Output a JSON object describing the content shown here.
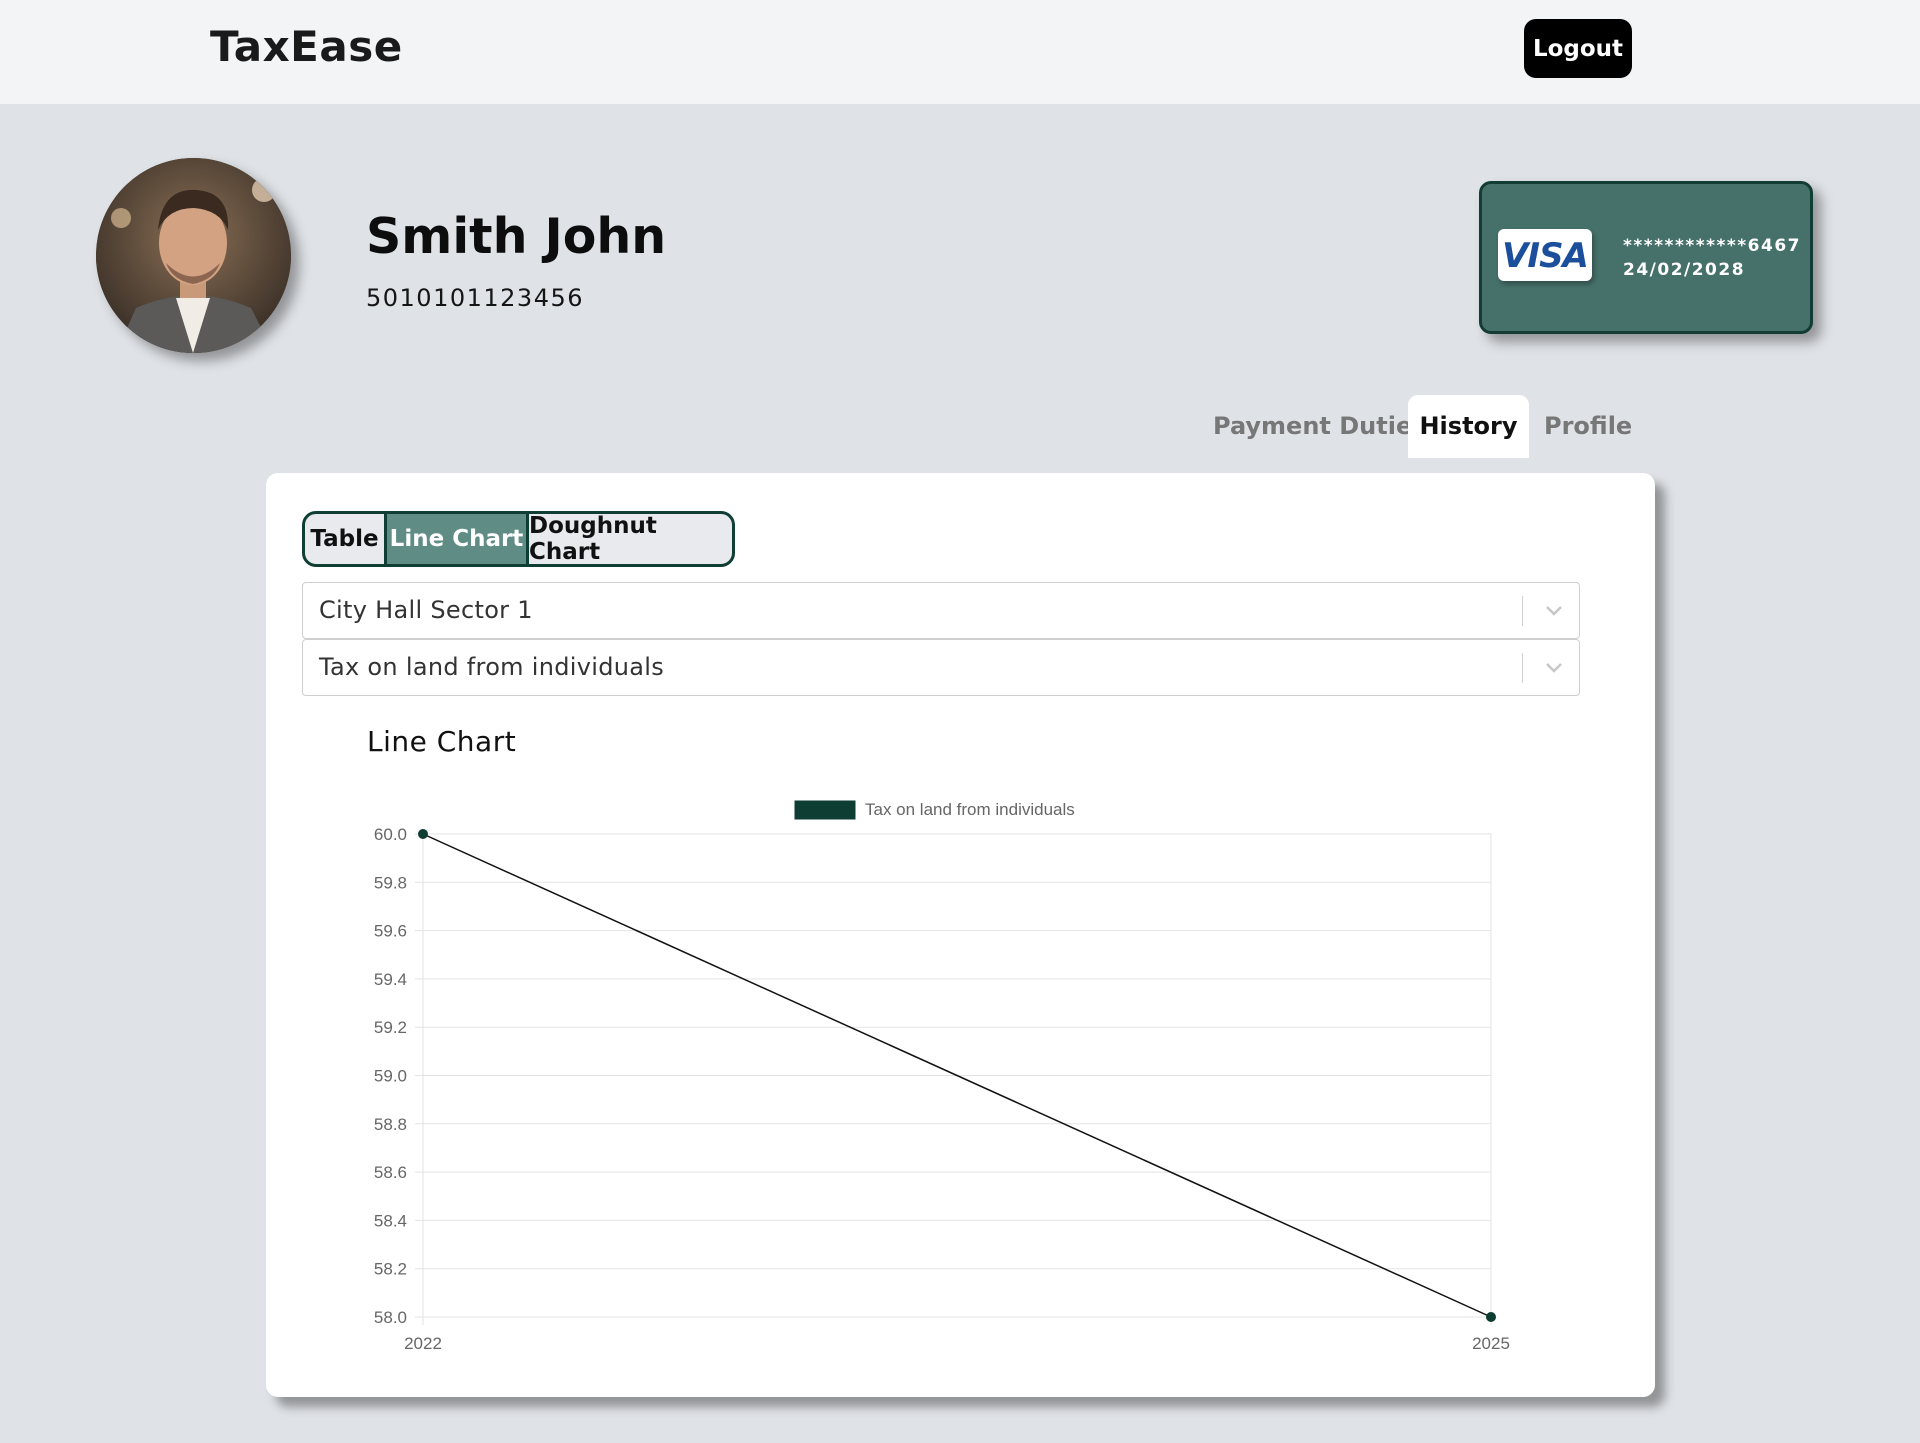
{
  "header": {
    "brand": "TaxEase",
    "logout_label": "Logout"
  },
  "user": {
    "name": "Smith John",
    "id_number": "5010101123456"
  },
  "card": {
    "brand": "VISA",
    "masked_number": "************6467",
    "expiry": "24/02/2028"
  },
  "tabs": [
    {
      "label": "Payment Duties",
      "active": false
    },
    {
      "label": "History",
      "active": true
    },
    {
      "label": "Profile",
      "active": false
    }
  ],
  "view_toggle": [
    {
      "label": "Table",
      "active": false
    },
    {
      "label": "Line Chart",
      "active": true
    },
    {
      "label": "Doughnut Chart",
      "active": false
    }
  ],
  "filters": {
    "institution": "City Hall Sector 1",
    "tax_type": "Tax on land from individuals"
  },
  "chart_section": {
    "title": "Line Chart"
  },
  "colors": {
    "accent": "#5f8c85",
    "card_bg": "#46706a",
    "series": "#0d3d33",
    "border": "#0f3e35"
  },
  "chart_data": {
    "type": "line",
    "title": "",
    "xlabel": "",
    "ylabel": "",
    "categories": [
      "2022",
      "2025"
    ],
    "series": [
      {
        "name": "Tax on land from individuals",
        "values": [
          60.0,
          58.0
        ]
      }
    ],
    "ylim": [
      58.0,
      60.0
    ],
    "yticks": [
      "60.0",
      "59.8",
      "59.6",
      "59.4",
      "59.2",
      "59.0",
      "58.8",
      "58.6",
      "58.4",
      "58.2",
      "58.0"
    ],
    "grid": true,
    "legend": "top-center"
  }
}
